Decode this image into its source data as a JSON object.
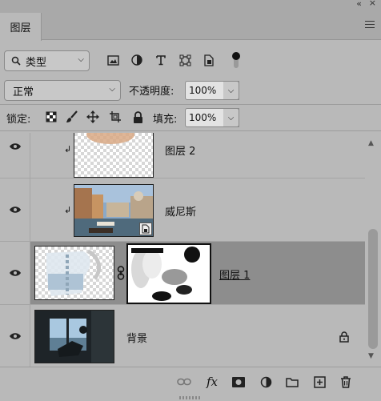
{
  "panel": {
    "tab_label": "图层"
  },
  "filter": {
    "kind_label": "类型"
  },
  "blend": {
    "mode": "正常",
    "opacity_label": "不透明度:",
    "opacity_value": "100%"
  },
  "lock": {
    "label": "锁定:",
    "fill_label": "填充:",
    "fill_value": "100%"
  },
  "layers": [
    {
      "name": "图层 2",
      "clipped": true,
      "visible": true
    },
    {
      "name": "威尼斯",
      "clipped": true,
      "visible": true,
      "smart_object": true
    },
    {
      "name": "图层 1",
      "clipped": false,
      "visible": true,
      "selected": true,
      "has_mask": true
    },
    {
      "name": "背景",
      "clipped": false,
      "visible": true,
      "locked": true
    }
  ],
  "footer": {
    "fx_label": "fx"
  },
  "colors": {
    "panel_bg": "#b9b9b9",
    "selected_row": "#8d8d8d"
  }
}
